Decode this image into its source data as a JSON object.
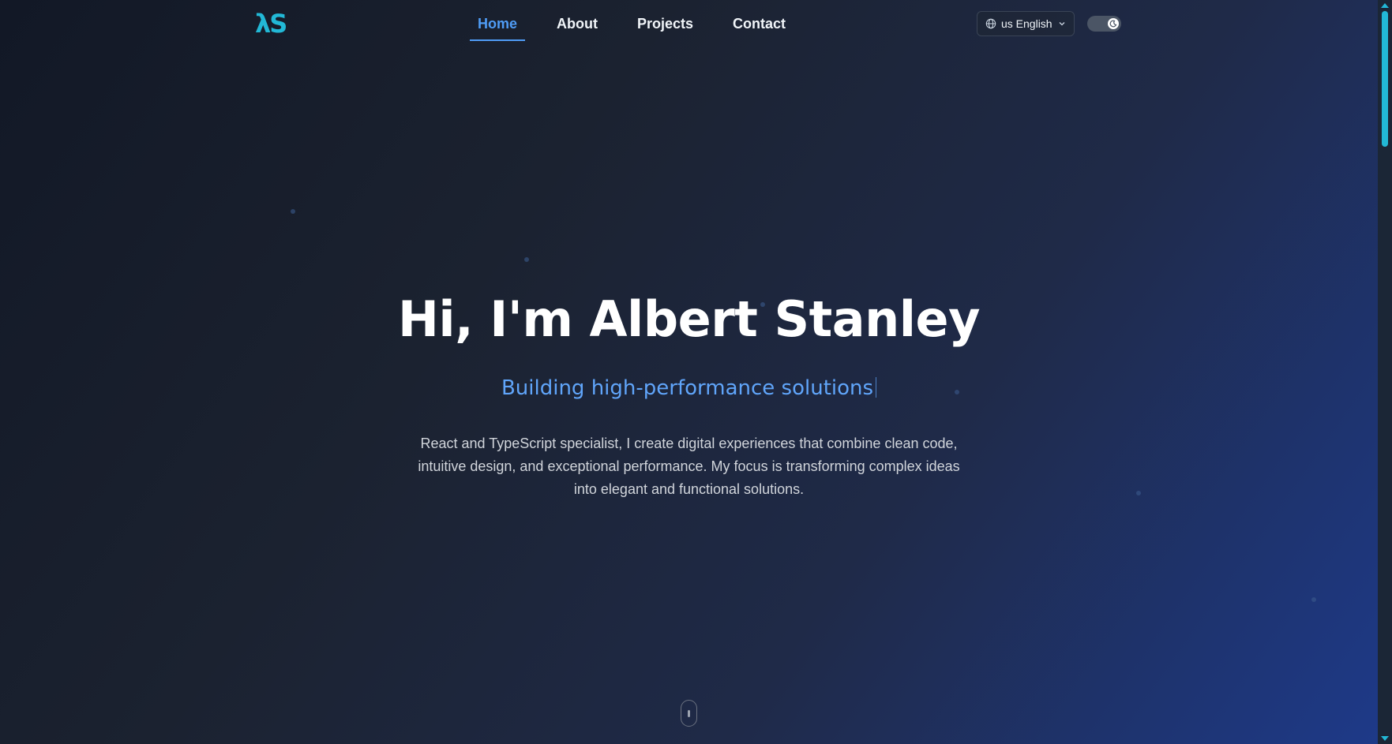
{
  "header": {
    "logo_text": "λS",
    "nav": [
      {
        "label": "Home",
        "active": true
      },
      {
        "label": "About",
        "active": false
      },
      {
        "label": "Projects",
        "active": false
      },
      {
        "label": "Contact",
        "active": false
      }
    ],
    "language": {
      "icon": "globe-icon",
      "flag_code": "us",
      "label": "English",
      "display": "us English",
      "chevron": "chevron-down-icon"
    },
    "theme_toggle": {
      "icon": "moon-icon",
      "state": "dark"
    }
  },
  "hero": {
    "title": "Hi, I'm Albert Stanley",
    "subtitle": "Building high-performance solutions",
    "description": "React and TypeScript specialist, I create digital experiences that combine clean code, intuitive design, and exceptional performance. My focus is transforming complex ideas into elegant and functional solutions."
  },
  "scroll_indicator": {
    "icon": "mouse-scroll-icon"
  },
  "colors": {
    "accent": "#4f9cf5",
    "logo": "#22b8d6",
    "subtitle": "#60a5fa",
    "background_start": "#121826",
    "background_end": "#1e3a8a"
  }
}
